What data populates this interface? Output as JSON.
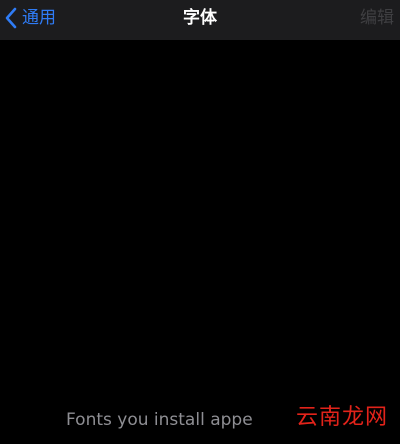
{
  "nav_bar": {
    "back_label": "通用",
    "title": "字体",
    "edit_label": "编辑"
  },
  "content": {
    "empty_message": "Fonts you install appe"
  },
  "watermark": {
    "text": "云南龙网"
  },
  "icons": {
    "back": "chevron-left-icon"
  },
  "colors": {
    "background": "#000000",
    "nav_background": "#1c1c1e",
    "accent": "#2f7cf6",
    "title_text": "#ffffff",
    "disabled_text": "#3f3f42",
    "secondary_text": "#8e8e93",
    "watermark": "#e2231a"
  }
}
